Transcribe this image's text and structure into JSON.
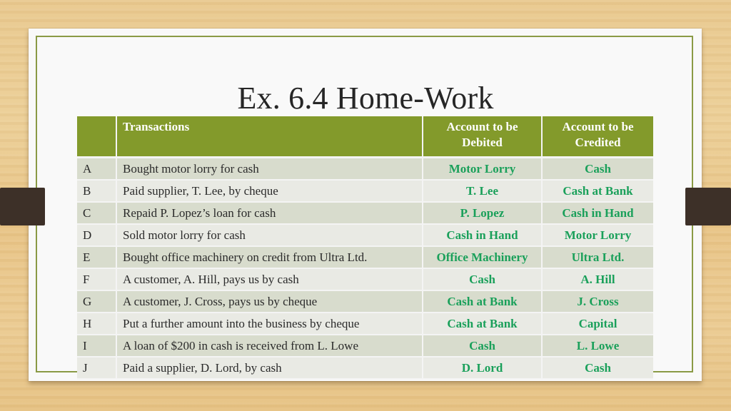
{
  "slide": {
    "title": "Ex. 6.4 Home-Work",
    "colors": {
      "header_bg": "#839a2b",
      "row_odd_bg": "#d8dccd",
      "row_even_bg": "#e9eae4",
      "account_text": "#1aa05a",
      "frame_border": "#8a9a45",
      "side_tab": "#3d3028"
    }
  },
  "table": {
    "headers": [
      "",
      "Transactions",
      "Account to be Debited",
      "Account to be Credited"
    ],
    "rows": [
      {
        "id": "A",
        "transaction": "Bought motor lorry for cash",
        "debit": "Motor Lorry",
        "credit": "Cash"
      },
      {
        "id": "B",
        "transaction": "Paid supplier, T. Lee, by cheque",
        "debit": "T. Lee",
        "credit": "Cash at Bank"
      },
      {
        "id": "C",
        "transaction": "Repaid P. Lopez’s loan for cash",
        "debit": "P. Lopez",
        "credit": "Cash in Hand"
      },
      {
        "id": "D",
        "transaction": "Sold motor lorry for cash",
        "debit": "Cash in Hand",
        "credit": "Motor Lorry"
      },
      {
        "id": "E",
        "transaction": "Bought office machinery on credit from Ultra Ltd.",
        "debit": "Office Machinery",
        "credit": "Ultra Ltd."
      },
      {
        "id": "F",
        "transaction": "A customer, A. Hill, pays us by cash",
        "debit": "Cash",
        "credit": "A. Hill"
      },
      {
        "id": "G",
        "transaction": "A customer, J. Cross, pays us by cheque",
        "debit": "Cash at Bank",
        "credit": "J. Cross"
      },
      {
        "id": "H",
        "transaction": "Put a further amount into the business by cheque",
        "debit": "Cash at Bank",
        "credit": "Capital"
      },
      {
        "id": "I",
        "transaction": "A loan of $200 in cash is received from L. Lowe",
        "debit": "Cash",
        "credit": "L. Lowe"
      },
      {
        "id": "J",
        "transaction": "Paid a supplier, D. Lord, by cash",
        "debit": "D. Lord",
        "credit": "Cash"
      }
    ]
  }
}
